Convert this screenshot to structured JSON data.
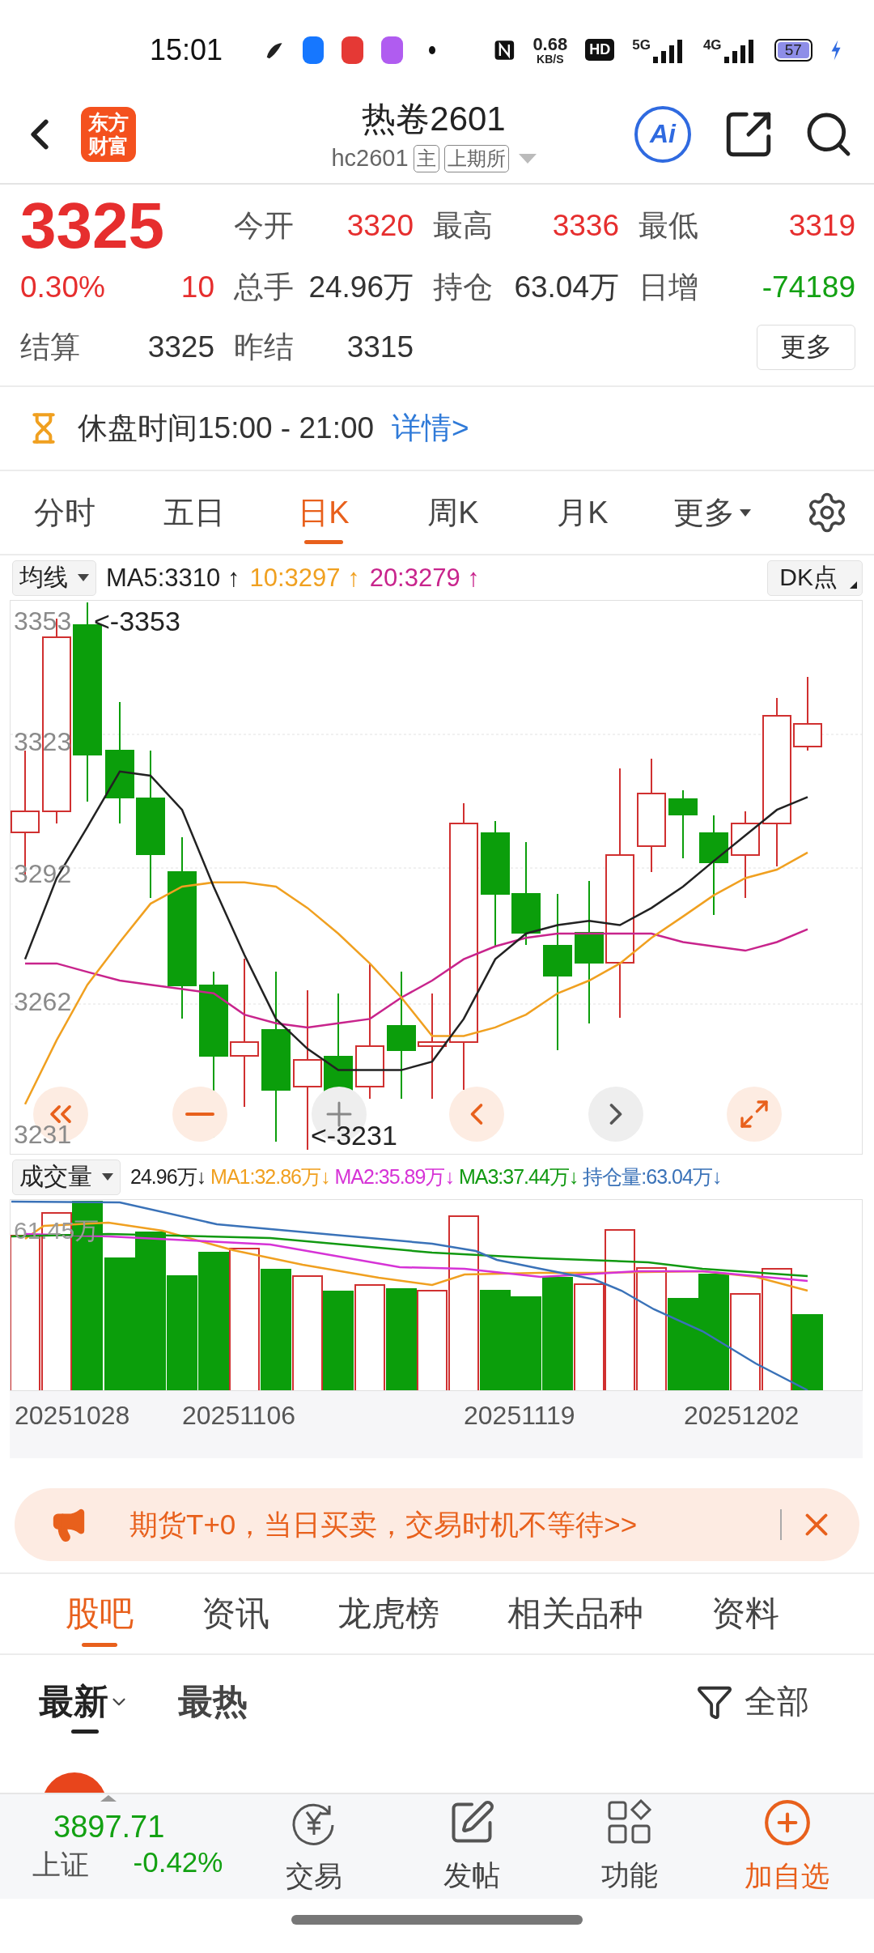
{
  "status_bar": {
    "time": "15:01",
    "net_speed": "0.68",
    "net_unit": "KB/S",
    "hd": "HD",
    "signal_1": "5G",
    "signal_2": "4G",
    "battery": "57"
  },
  "header": {
    "logo": [
      "东方",
      "财富"
    ],
    "title": "热卷2601",
    "code": "hc2601",
    "badges": [
      "主",
      "上期所"
    ],
    "ai": "Ai"
  },
  "quote": {
    "price": "3325",
    "color": "#e62e2e",
    "change_pct": "0.30%",
    "change": "10",
    "stats": [
      {
        "label": "今开",
        "value": "3320",
        "color": "#e62e2e"
      },
      {
        "label": "最高",
        "value": "3336",
        "color": "#e62e2e"
      },
      {
        "label": "最低",
        "value": "3319",
        "color": "#e62e2e"
      },
      {
        "label": "总手",
        "value": "24.96万",
        "color": "#333333"
      },
      {
        "label": "持仓",
        "value": "63.04万",
        "color": "#333333"
      },
      {
        "label": "日增",
        "value": "-74189",
        "color": "#13a113"
      }
    ],
    "settle": {
      "label": "结算",
      "value": "3325"
    },
    "prev_settle": {
      "label": "昨结",
      "value": "3315"
    },
    "more": "更多"
  },
  "break_notice": {
    "text": "休盘时间15:00 - 21:00",
    "link": "详情>"
  },
  "period_tabs": [
    {
      "label": "分时",
      "selected": false
    },
    {
      "label": "五日",
      "selected": false
    },
    {
      "label": "日K",
      "selected": true
    },
    {
      "label": "周K",
      "selected": false
    },
    {
      "label": "月K",
      "selected": false
    },
    {
      "label": "更多",
      "selected": false,
      "kind": "dropdown"
    }
  ],
  "ma_legend": {
    "selector": "均线",
    "items": [
      {
        "text": "MA5:3310",
        "arrow": "↑",
        "color": "#222222"
      },
      {
        "text": "10:3297",
        "arrow": "↑",
        "color": "#f0a020"
      },
      {
        "text": "20:3279",
        "arrow": "↑",
        "color": "#c8248c"
      }
    ],
    "dk": "DK点"
  },
  "price_chart": {
    "high_marker": "<-3353",
    "low_marker": "<-3231",
    "chart_data": {
      "type": "line",
      "ylim": [
        3226,
        3356
      ],
      "yticks": [
        {
          "value": 3353,
          "label": "3353"
        },
        {
          "value": 3323,
          "label": "3323"
        },
        {
          "value": 3292,
          "label": "3292"
        },
        {
          "value": 3262,
          "label": "3262"
        },
        {
          "value": 3231,
          "label": "3231"
        }
      ],
      "series": [
        {
          "color": "#222222",
          "values": [
            3272,
            3291,
            3303,
            3316,
            3315,
            3307,
            3289,
            3273,
            3258,
            3251,
            3246,
            3246,
            3246,
            3248,
            3258,
            3272,
            3278,
            3280,
            3281,
            3280,
            3284,
            3289,
            3295,
            3301,
            3307,
            3310
          ]
        },
        {
          "color": "#f0a020",
          "values": [
            3238,
            3253,
            3266,
            3276,
            3285,
            3289,
            3290,
            3290,
            3289,
            3284,
            3278,
            3271,
            3263,
            3254,
            3254,
            3256,
            3259,
            3264,
            3267,
            3271,
            3277,
            3282,
            3287,
            3291,
            3293,
            3297
          ]
        },
        {
          "color": "#c8248c",
          "values": [
            3271,
            3271,
            3269,
            3267,
            3266,
            3265,
            3264,
            3259,
            3257,
            3256,
            3257,
            3258,
            3263,
            3267,
            3272,
            3275,
            3277,
            3278,
            3278,
            3278,
            3278,
            3276,
            3275,
            3274,
            3276,
            3279
          ]
        }
      ]
    }
  },
  "volume_legend": {
    "selector": "成交量",
    "items": [
      {
        "text": "24.96万",
        "arrow": "↓",
        "color": "#222222"
      },
      {
        "text": "MA1:32.86万",
        "arrow": "↓",
        "color": "#f0a020"
      },
      {
        "text": "MA2:35.89万",
        "arrow": "↓",
        "color": "#d633d6"
      },
      {
        "text": "MA3:37.44万",
        "arrow": "↓",
        "color": "#119911"
      },
      {
        "text": "持仓量:63.04万",
        "arrow": "↓",
        "color": "#3a72b8"
      }
    ]
  },
  "volume_chart": {
    "max_label": "61.45万",
    "dates": [
      "20251028",
      "20251106",
      "20251119",
      "20251202"
    ]
  },
  "banner": {
    "text": "期货T+0，当日买卖，交易时机不等待>>"
  },
  "section_tabs": [
    {
      "label": "股吧",
      "selected": true
    },
    {
      "label": "资讯",
      "selected": false
    },
    {
      "label": "龙虎榜",
      "selected": false
    },
    {
      "label": "相关品种",
      "selected": false
    },
    {
      "label": "资料",
      "selected": false
    }
  ],
  "sort_tabs": [
    {
      "label": "最新",
      "selected": true,
      "kind": "dropdown"
    },
    {
      "label": "最热",
      "selected": false
    }
  ],
  "filter": {
    "label": "全部"
  },
  "bottom_bar": {
    "index": {
      "value": "3897.71",
      "name": "上证",
      "change": "-0.42%",
      "color": "#13a113"
    },
    "items": [
      {
        "label": "交易",
        "kind": "trade"
      },
      {
        "label": "发帖",
        "kind": "post"
      },
      {
        "label": "功能",
        "kind": "apps"
      },
      {
        "label": "加自选",
        "kind": "add"
      }
    ]
  }
}
